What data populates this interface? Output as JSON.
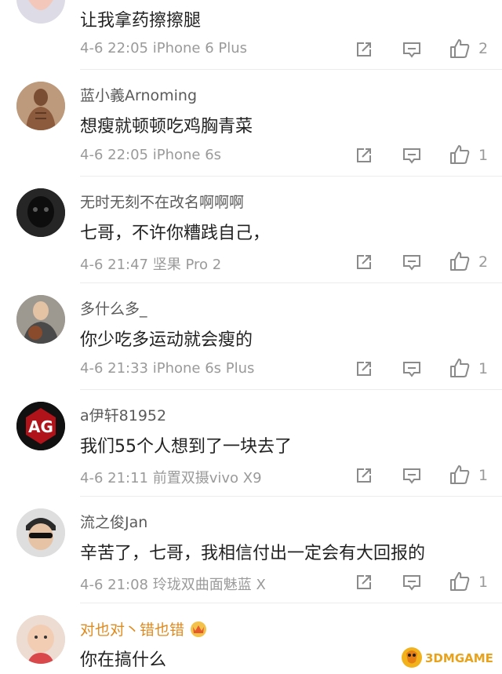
{
  "comments": [
    {
      "username": "",
      "text": "让我拿药擦擦腿",
      "date": "4-6 22:05",
      "device": "iPhone 6 Plus",
      "likes": "2"
    },
    {
      "username": "蓝小義Arnoming",
      "text": "想瘦就顿顿吃鸡胸青菜",
      "date": "4-6 22:05",
      "device": "iPhone 6s",
      "likes": "1"
    },
    {
      "username": "无时无刻不在改名啊啊啊",
      "text": "七哥，不许你糟践自己，",
      "date": "4-6 21:47",
      "device": "坚果 Pro 2",
      "likes": "2"
    },
    {
      "username": "多什么多_",
      "text": "你少吃多运动就会瘦的",
      "date": "4-6 21:33",
      "device": "iPhone 6s Plus",
      "likes": "1"
    },
    {
      "username": "a伊轩81952",
      "text": "我们55个人想到了一块去了",
      "date": "4-6 21:11",
      "device": "前置双摄vivo X9",
      "likes": "1"
    },
    {
      "username": "流之俊Jan",
      "text": "辛苦了，七哥，我相信付出一定会有大回报的",
      "date": "4-6 21:08",
      "device": "玲珑双曲面魅蓝 X",
      "likes": "1"
    },
    {
      "username": "对也对丶错也错",
      "text": "你在搞什么",
      "date": "",
      "device": "",
      "likes": ""
    }
  ],
  "icons": {
    "share": "share-icon",
    "comment": "comment-icon",
    "like": "thumbs-up-icon",
    "vip": "crown-badge-icon"
  },
  "colors": {
    "username": "#5a5a5a",
    "vip_username": "#e08a1e",
    "meta": "#9a9a9a",
    "text": "#222222"
  },
  "watermark": "3DMGAME"
}
